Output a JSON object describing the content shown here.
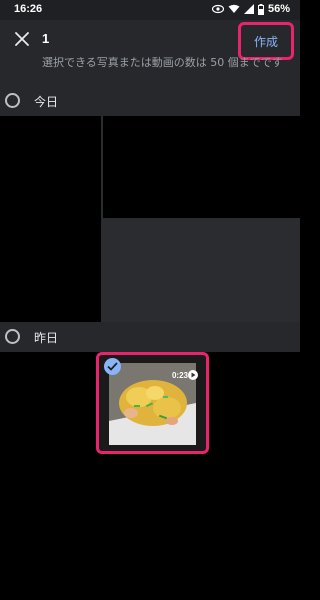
{
  "status_bar": {
    "time": "16:26",
    "battery": "56%"
  },
  "header": {
    "selected_count": "1",
    "create_label": "作成",
    "hint": "選択できる写真または動画の数は 50 個までです"
  },
  "sections": [
    {
      "label": "今日"
    },
    {
      "label": "昨日"
    }
  ],
  "selected_item": {
    "duration": "0:23"
  },
  "icons": [
    "close-icon",
    "check-icon",
    "play-icon",
    "wifi-icon",
    "signal-icon",
    "battery-icon",
    "eye-icon"
  ],
  "colors": {
    "highlight": "#e8246d",
    "accent": "#8ab4f8",
    "header_bg": "#27282c"
  }
}
